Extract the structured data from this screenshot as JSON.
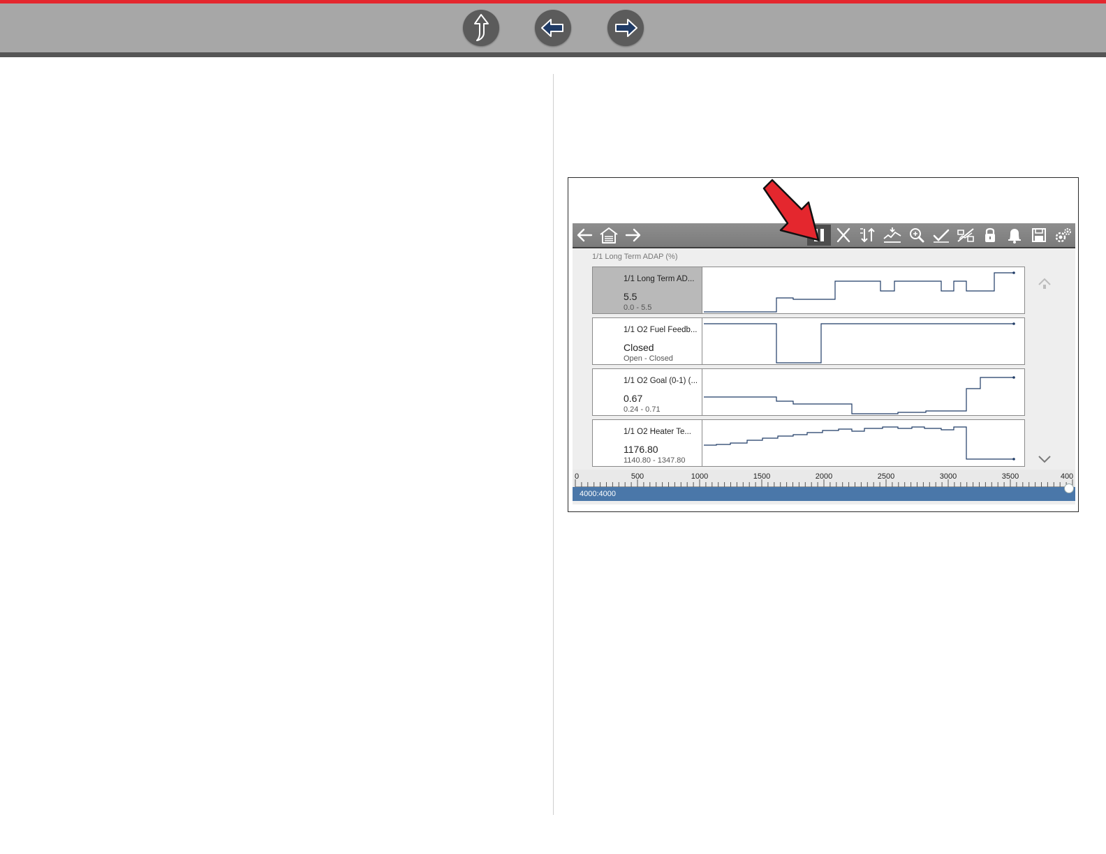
{
  "header": {
    "nav_buttons": [
      {
        "name": "up-arrow-icon",
        "label": "Up"
      },
      {
        "name": "left-arrow-icon",
        "label": "Back"
      },
      {
        "name": "right-arrow-icon",
        "label": "Forward"
      }
    ],
    "colors": {
      "accent_strip": "#e4272e",
      "bar": "#a7a7a7",
      "button": "#5b5b5b"
    }
  },
  "screen": {
    "toolbar": {
      "left_icons": [
        "back-arrow-icon",
        "garage-home-icon",
        "forward-arrow-icon"
      ],
      "right_icons": [
        "pause-icon",
        "close-x-icon",
        "sort-icon",
        "graph-scale-icon",
        "zoom-icon",
        "check-icon",
        "pid-trigger-icon",
        "lock-icon",
        "bell-icon",
        "save-icon",
        "settings-icon"
      ],
      "active_icon": "pause-icon"
    },
    "graph_title": "1/1 Long Term ADAP (%)",
    "rows": [
      {
        "name": "1/1 Long Term AD...",
        "value": "5.5",
        "range": "0.0 - 5.5",
        "selected": true
      },
      {
        "name": "1/1 O2 Fuel Feedb...",
        "value": "Closed",
        "range": "Open - Closed",
        "selected": false
      },
      {
        "name": "1/1 O2 Goal (0-1) (...",
        "value": "0.67",
        "range": "0.24 - 0.71",
        "selected": false
      },
      {
        "name": "1/1 O2 Heater Te...",
        "value": "1176.80",
        "range": "1140.80 - 1347.80",
        "selected": false
      }
    ],
    "ruler": {
      "labels": [
        "0",
        "500",
        "1000",
        "1500",
        "2000",
        "2500",
        "3000",
        "3500",
        "400"
      ],
      "max": 4000
    },
    "progress": {
      "label": "4000:4000",
      "fraction": 1.0
    }
  }
}
